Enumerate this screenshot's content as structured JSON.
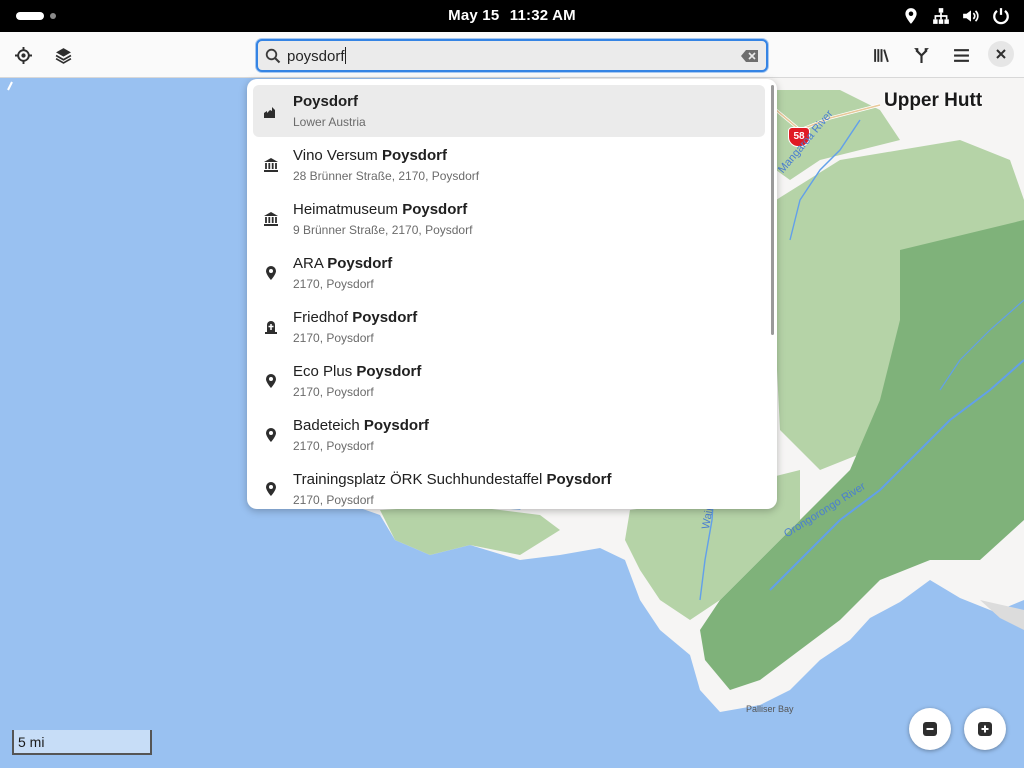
{
  "topbar": {
    "date": "May 15",
    "time": "11:32 AM",
    "icons": [
      "activities-indicator",
      "location-icon",
      "network-icon",
      "volume-icon",
      "power-icon"
    ]
  },
  "header": {
    "left_icons": [
      "locate-icon",
      "layers-icon"
    ],
    "search": {
      "value": "poysdorf"
    },
    "right_icons": [
      "library-icon",
      "route-icon",
      "menu-icon",
      "close-icon"
    ]
  },
  "results": [
    {
      "icon": "town-icon",
      "title_plain": "",
      "title_bold": "Poysdorf",
      "subtitle": "Lower Austria",
      "selected": true
    },
    {
      "icon": "museum-icon",
      "title_plain": "Vino Versum ",
      "title_bold": "Poysdorf",
      "subtitle": "28 Brünner Straße, 2170, Poysdorf"
    },
    {
      "icon": "museum-icon",
      "title_plain": "Heimatmuseum ",
      "title_bold": "Poysdorf",
      "subtitle": "9 Brünner Straße, 2170, Poysdorf"
    },
    {
      "icon": "place-pin-icon",
      "title_plain": "ARA ",
      "title_bold": "Poysdorf",
      "subtitle": "2170, Poysdorf"
    },
    {
      "icon": "cemetery-icon",
      "title_plain": "Friedhof ",
      "title_bold": "Poysdorf",
      "subtitle": "2170, Poysdorf"
    },
    {
      "icon": "place-pin-icon",
      "title_plain": "Eco Plus ",
      "title_bold": "Poysdorf",
      "subtitle": "2170, Poysdorf"
    },
    {
      "icon": "place-pin-icon",
      "title_plain": "Badeteich ",
      "title_bold": "Poysdorf",
      "subtitle": "2170, Poysdorf"
    },
    {
      "icon": "place-pin-icon",
      "title_plain": "Trainingsplatz ÖRK Suchhundestaffel ",
      "title_bold": "Poysdorf",
      "subtitle": "2170, Poysdorf"
    }
  ],
  "map": {
    "city_label": "Upper Hutt",
    "road_shield": "58",
    "rivers": [
      "Mangaroa River",
      "Orongorongo River",
      "Wainuiomata River"
    ],
    "bay_label": "Palliser Bay",
    "scale_label": "5 mi",
    "colors": {
      "water": "#99c1f1",
      "land": "#f6f5f4",
      "forest": "#b5d3a7",
      "forest_dark": "#7fb27a",
      "river": "#62a0ea"
    }
  },
  "zoom": {
    "out_icon": "zoom-out-icon",
    "in_icon": "zoom-in-icon"
  }
}
